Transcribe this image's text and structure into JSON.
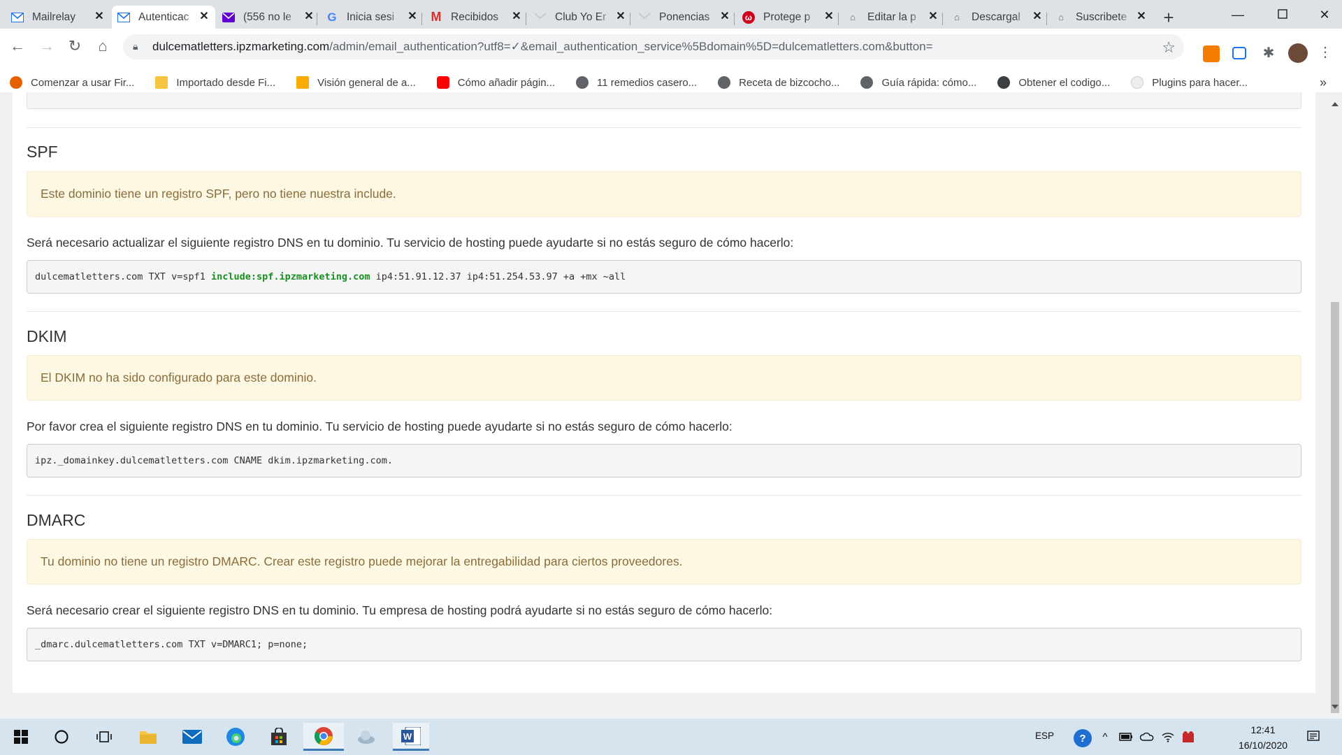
{
  "tabs": [
    {
      "title": "Mailrelay",
      "icon": "mail-icon",
      "active": false
    },
    {
      "title": "Autenticac",
      "icon": "mail-icon",
      "active": true
    },
    {
      "title": "(556 no le",
      "icon": "yahoo-mail-icon",
      "active": false
    },
    {
      "title": "Inicia sesi",
      "icon": "google-icon",
      "active": false
    },
    {
      "title": "Recibidos",
      "icon": "gmail-icon",
      "active": false
    },
    {
      "title": "Club Yo Er",
      "icon": "mail-icon",
      "active": false
    },
    {
      "title": "Ponencias",
      "icon": "mail-icon",
      "active": false
    },
    {
      "title": "Protege p",
      "icon": "protect-icon",
      "active": false
    },
    {
      "title": "Editar la p",
      "icon": "site-icon",
      "active": false
    },
    {
      "title": "Descargal",
      "icon": "site-icon",
      "active": false
    },
    {
      "title": "Suscribete",
      "icon": "site-icon",
      "active": false
    }
  ],
  "url": {
    "host": "dulcematletters.ipzmarketing.com",
    "path": "/admin/email_authentication?utf8=✓&email_authentication_service%5Bdomain%5D=dulcematletters.com&button="
  },
  "bookmarks": [
    {
      "label": "Comenzar a usar Fir...",
      "color": "#e66000"
    },
    {
      "label": "Importado desde Fi...",
      "color": "#f5c542"
    },
    {
      "label": "Visión general de a...",
      "color": "#f9ab00"
    },
    {
      "label": "Cómo añadir págin...",
      "color": "#ff0000"
    },
    {
      "label": "11 remedios casero...",
      "color": "#5f6368"
    },
    {
      "label": "Receta de bizcocho...",
      "color": "#5f6368"
    },
    {
      "label": "Guía rápida: cómo...",
      "color": "#5f6368"
    },
    {
      "label": "Obtener el codigo...",
      "color": "#3c4043"
    },
    {
      "label": "Plugins para hacer...",
      "color": "#e8e8e8"
    }
  ],
  "sections": {
    "spf": {
      "title": "SPF",
      "alert": "Este dominio tiene un registro SPF, pero no tiene nuestra include.",
      "desc": "Será necesario actualizar el siguiente registro DNS en tu dominio. Tu servicio de hosting puede ayudarte si no estás seguro de cómo hacerlo:",
      "code_before": "dulcematletters.com TXT v=spf1 ",
      "code_include": "include:spf.ipzmarketing.com",
      "code_after": " ip4:51.91.12.37 ip4:51.254.53.97 +a +mx ~all"
    },
    "dkim": {
      "title": "DKIM",
      "alert": "El DKIM no ha sido configurado para este dominio.",
      "desc": "Por favor crea el siguiente registro DNS en tu dominio. Tu servicio de hosting puede ayudarte si no estás seguro de cómo hacerlo:",
      "code": "ipz._domainkey.dulcematletters.com CNAME dkim.ipzmarketing.com."
    },
    "dmarc": {
      "title": "DMARC",
      "alert": "Tu dominio no tiene un registro DMARC. Crear este registro puede mejorar la entregabilidad para ciertos proveedores.",
      "desc": "Será necesario crear el siguiente registro DNS en tu dominio. Tu empresa de hosting podrá ayudarte si no estás seguro de cómo hacerlo:",
      "code": "_dmarc.dulcematletters.com TXT v=DMARC1; p=none;"
    }
  },
  "taskbar": {
    "lang": "ESP",
    "time": "12:41",
    "date": "16/10/2020"
  },
  "colors": {
    "alert_bg": "#fcf8e3",
    "alert_text": "#8a6d3b",
    "include_green": "#198f23"
  }
}
